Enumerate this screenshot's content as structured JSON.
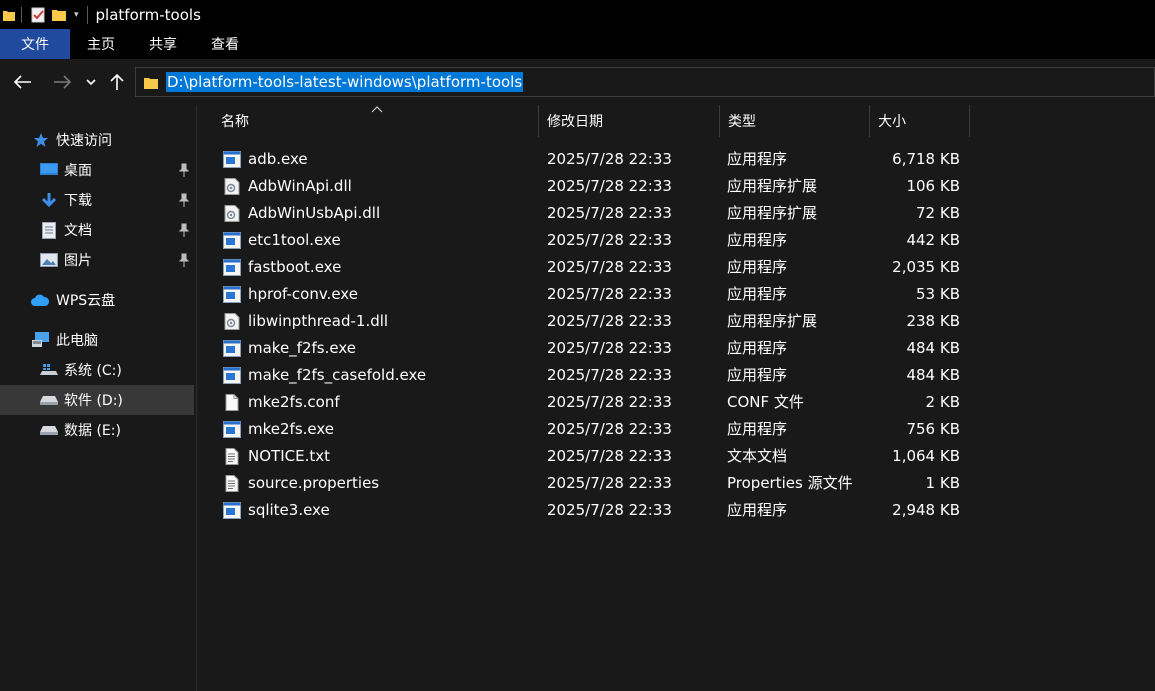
{
  "window": {
    "title": "platform-tools"
  },
  "ribbon": {
    "tabs": [
      "文件",
      "主页",
      "共享",
      "查看"
    ]
  },
  "address": {
    "path": "D:\\platform-tools-latest-windows\\platform-tools"
  },
  "columns": {
    "name": "名称",
    "date": "修改日期",
    "type": "类型",
    "size": "大小"
  },
  "sidebar": {
    "quick_access": "快速访问",
    "pinned": [
      "桌面",
      "下载",
      "文档",
      "图片"
    ],
    "wps": "WPS云盘",
    "this_pc": "此电脑",
    "drives": [
      "系统 (C:)",
      "软件 (D:)",
      "数据 (E:)"
    ],
    "selected": "软件 (D:)"
  },
  "files": [
    {
      "name": "adb.exe",
      "date": "2025/7/28 22:33",
      "type": "应用程序",
      "size": "6,718 KB",
      "icon": "exe-icon"
    },
    {
      "name": "AdbWinApi.dll",
      "date": "2025/7/28 22:33",
      "type": "应用程序扩展",
      "size": "106 KB",
      "icon": "dll-icon"
    },
    {
      "name": "AdbWinUsbApi.dll",
      "date": "2025/7/28 22:33",
      "type": "应用程序扩展",
      "size": "72 KB",
      "icon": "dll-icon"
    },
    {
      "name": "etc1tool.exe",
      "date": "2025/7/28 22:33",
      "type": "应用程序",
      "size": "442 KB",
      "icon": "exe-icon"
    },
    {
      "name": "fastboot.exe",
      "date": "2025/7/28 22:33",
      "type": "应用程序",
      "size": "2,035 KB",
      "icon": "exe-icon"
    },
    {
      "name": "hprof-conv.exe",
      "date": "2025/7/28 22:33",
      "type": "应用程序",
      "size": "53 KB",
      "icon": "exe-icon"
    },
    {
      "name": "libwinpthread-1.dll",
      "date": "2025/7/28 22:33",
      "type": "应用程序扩展",
      "size": "238 KB",
      "icon": "dll-icon"
    },
    {
      "name": "make_f2fs.exe",
      "date": "2025/7/28 22:33",
      "type": "应用程序",
      "size": "484 KB",
      "icon": "exe-icon"
    },
    {
      "name": "make_f2fs_casefold.exe",
      "date": "2025/7/28 22:33",
      "type": "应用程序",
      "size": "484 KB",
      "icon": "exe-icon"
    },
    {
      "name": "mke2fs.conf",
      "date": "2025/7/28 22:33",
      "type": "CONF 文件",
      "size": "2 KB",
      "icon": "blank-file-icon"
    },
    {
      "name": "mke2fs.exe",
      "date": "2025/7/28 22:33",
      "type": "应用程序",
      "size": "756 KB",
      "icon": "exe-icon"
    },
    {
      "name": "NOTICE.txt",
      "date": "2025/7/28 22:33",
      "type": "文本文档",
      "size": "1,064 KB",
      "icon": "text-file-icon"
    },
    {
      "name": "source.properties",
      "date": "2025/7/28 22:33",
      "type": "Properties 源文件",
      "size": "1 KB",
      "icon": "text-file-icon"
    },
    {
      "name": "sqlite3.exe",
      "date": "2025/7/28 22:33",
      "type": "应用程序",
      "size": "2,948 KB",
      "icon": "exe-icon"
    }
  ]
}
